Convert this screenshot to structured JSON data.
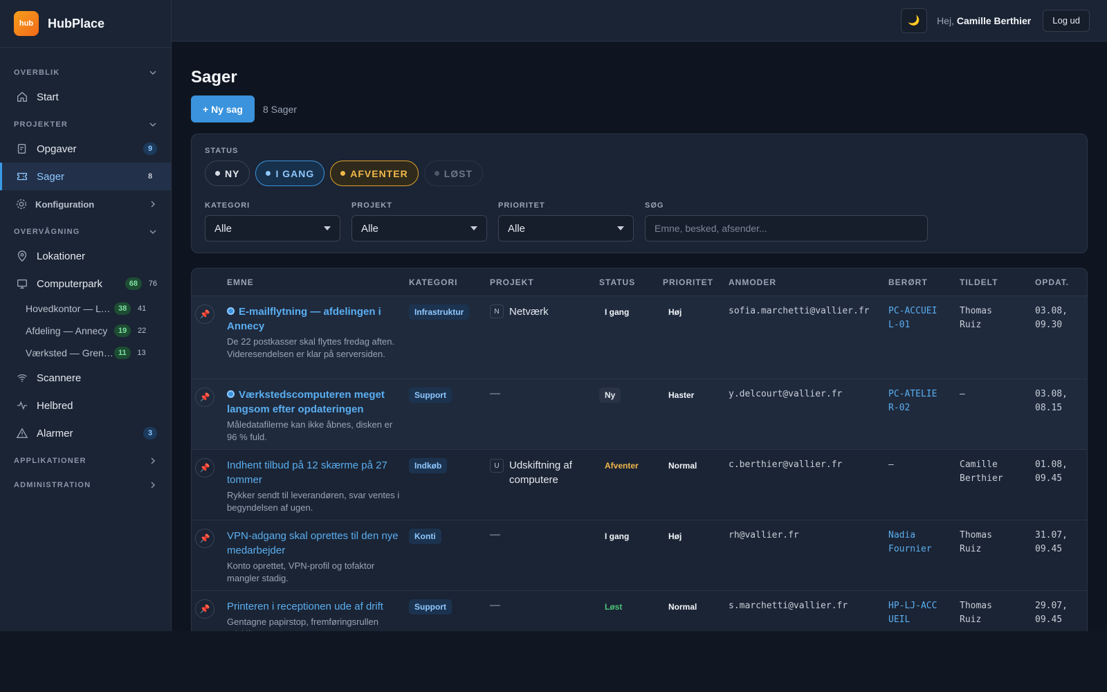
{
  "brand": {
    "logo": "hub",
    "name": "HubPlace"
  },
  "sidebar": {
    "overblik": "OVERBLIK",
    "start": "Start",
    "projekter": "PROJEKTER",
    "opgaver": "Opgaver",
    "opgaver_badge": "9",
    "sager": "Sager",
    "sager_badge": "8",
    "konfiguration": "Konfiguration",
    "overvaagning": "OVERVÅGNING",
    "lokationer": "Lokationer",
    "computerpark": "Computerpark",
    "computerpark_badge": "68",
    "computerpark_count": "76",
    "sub": [
      {
        "label": "Hovedkontor — Lyon",
        "badge": "38",
        "count": "41"
      },
      {
        "label": "Afdeling — Annecy",
        "badge": "19",
        "count": "22"
      },
      {
        "label": "Værksted — Grenoble",
        "badge": "11",
        "count": "13"
      }
    ],
    "scannere": "Scannere",
    "helbred": "Helbred",
    "alarmer": "Alarmer",
    "alarmer_badge": "3",
    "applikationer": "APPLIKATIONER",
    "administration": "ADMINISTRATION"
  },
  "header": {
    "theme_icon": "moon-icon",
    "greeting_prefix": "Hej,",
    "user_name": "Camille Berthier",
    "logout": "Log ud"
  },
  "page": {
    "title": "Sager",
    "new_button": "+ Ny sag",
    "count_label": "8 Sager"
  },
  "filters": {
    "status_label": "STATUS",
    "chips": [
      "NY",
      "I GANG",
      "AFVENTER",
      "LØST"
    ],
    "kategori_label": "KATEGORI",
    "kategori_value": "Alle",
    "projekt_label": "PROJEKT",
    "projekt_value": "Alle",
    "prioritet_label": "PRIORITET",
    "prioritet_value": "Alle",
    "search_label": "SØG",
    "search_placeholder": "Emne, besked, afsender..."
  },
  "table": {
    "headers": [
      "EMNE",
      "KATEGORI",
      "PROJEKT",
      "STATUS",
      "PRIORITET",
      "ANMODER",
      "BERØRT",
      "TILDELT",
      "OPDAT."
    ],
    "rows": [
      {
        "title": "E-mailflytning — afdelingen i Annecy",
        "desc": "De 22 postkasser skal flyttes fredag aften. Videresendelsen er klar på serversiden.",
        "category": "Infrastruktur",
        "project_letter": "N",
        "project": "Netværk",
        "status": "I gang",
        "priority": "Høj",
        "requester": "sofia.marchetti@vallier.fr",
        "affected": "PC-ACCUEIL-01",
        "assigned": "Thomas Ruiz",
        "updated": "03.08, 09.30"
      },
      {
        "title": "Værkstedscomputeren meget langsom efter opdateringen",
        "desc": "Måledatafilerne kan ikke åbnes, disken er 96 % fuld.",
        "category": "Support",
        "project_letter": "",
        "project": "—",
        "status": "Ny",
        "priority": "Haster",
        "requester": "y.delcourt@vallier.fr",
        "affected": "PC-ATELIER-02",
        "assigned": "—",
        "updated": "03.08, 08.15"
      },
      {
        "title": "Indhent tilbud på 12 skærme på 27 tommer",
        "desc": "Rykker sendt til leverandøren, svar ventes i begyndelsen af ugen.",
        "category": "Indkøb",
        "project_letter": "U",
        "project": "Udskiftning af computere",
        "status": "Afventer",
        "priority": "Normal",
        "requester": "c.berthier@vallier.fr",
        "affected": "—",
        "assigned": "Camille Berthier",
        "updated": "01.08, 09.45"
      },
      {
        "title": "VPN-adgang skal oprettes til den nye medarbejder",
        "desc": "Konto oprettet, VPN-profil og tofaktor mangler stadig.",
        "category": "Konti",
        "project_letter": "",
        "project": "—",
        "status": "I gang",
        "priority": "Høj",
        "requester": "rh@vallier.fr",
        "affected": "Nadia Fournier",
        "assigned": "Thomas Ruiz",
        "updated": "31.07, 09.45"
      },
      {
        "title": "Printeren i receptionen ude af drift",
        "desc": "Gentagne papirstop, fremføringsrullen udskiftes.",
        "category": "Support",
        "project_letter": "",
        "project": "—",
        "status": "Løst",
        "priority": "Normal",
        "requester": "s.marchetti@vallier.fr",
        "affected": "HP-LJ-ACCUEIL",
        "assigned": "Thomas Ruiz",
        "updated": "29.07, 09.45"
      }
    ]
  }
}
